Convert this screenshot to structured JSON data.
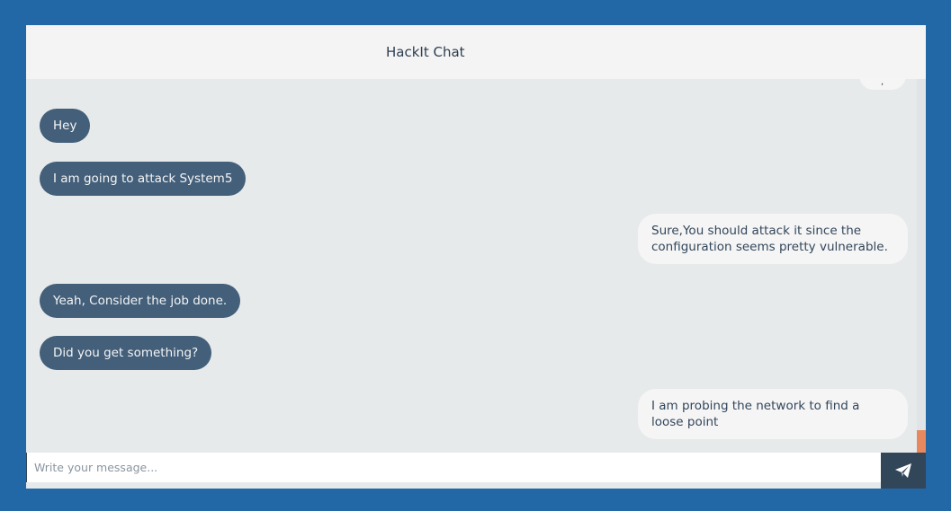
{
  "header": {
    "title": "HackIt Chat"
  },
  "messages": [
    {
      "direction": "sent",
      "text": "Hey"
    },
    {
      "direction": "sent",
      "text": "I am going to attack System5"
    },
    {
      "direction": "received",
      "text": "Sure,You should attack it since the configuration seems pretty vulnerable."
    },
    {
      "direction": "sent",
      "text": "Yeah, Consider the job done."
    },
    {
      "direction": "sent",
      "text": "Did you get something?"
    },
    {
      "direction": "received",
      "text": "I am probing the network to find a loose point"
    }
  ],
  "composer": {
    "placeholder": "Write your message...",
    "value": "",
    "send_icon": "paper-plane-icon"
  },
  "colors": {
    "page_background": "#2368a6",
    "header_background": "#f4f4f4",
    "messages_background": "#e6eaeb",
    "sent_bubble": "#435f7a",
    "received_bubble": "#f5f5f5",
    "send_button": "#32465a",
    "scroll_thumb": "#e7885e"
  }
}
